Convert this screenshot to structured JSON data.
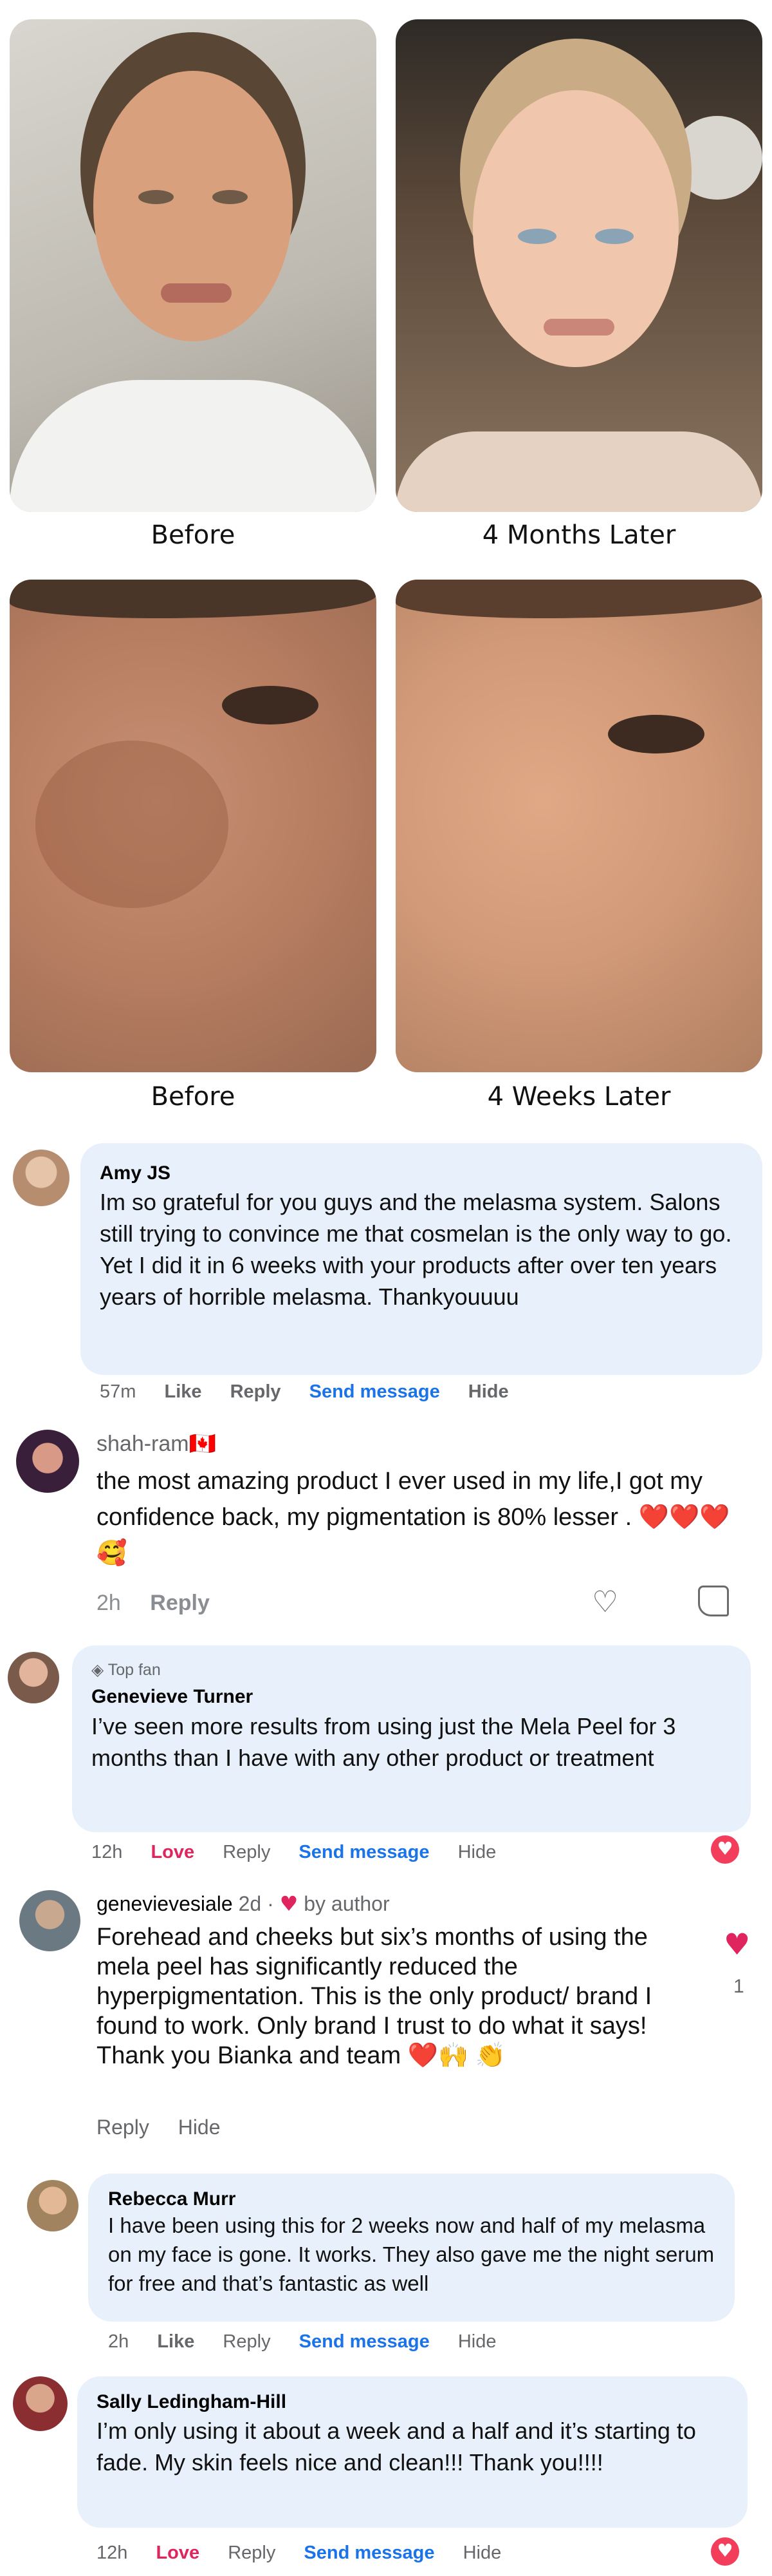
{
  "photos": {
    "top_left_caption": "Before",
    "top_right_caption": "4 Months Later",
    "bottom_left_caption": "Before",
    "bottom_right_caption": "4 Weeks Later"
  },
  "comments": [
    {
      "name": "Amy JS",
      "text": "Im so grateful for you guys and the melasma system. Salons still trying to convince me that cosmelan is the only way to go. Yet I did it in 6 weeks with your products after over ten years years of horrible melasma. Thankyouuuu",
      "time": "57m",
      "like": "Like",
      "reply": "Reply",
      "send": "Send message",
      "hide": "Hide"
    },
    {
      "name": "shah-ram🇨🇦",
      "text": "the most amazing product I ever used in my life,I got my confidence back, my pigmentation is 80% lesser .",
      "emoji": "❤️❤️❤️🥰",
      "time": "2h",
      "reply": "Reply"
    },
    {
      "badge": "Top fan",
      "name": "Genevieve Turner",
      "text": "I’ve seen more results from using just the Mela Peel for 3 months than I have with any other product or treatment",
      "time": "12h",
      "love": "Love",
      "reply": "Reply",
      "send": "Send message",
      "hide": "Hide"
    },
    {
      "name": "genevievesiale",
      "age": "2d",
      "by_author": "by author",
      "text": "Forehead and cheeks but six’s months of using the mela peel has significantly reduced the hyperpigmentation. This is the only product/ brand I found to work. Only brand I trust to do what it says! Thank you Bianka and team",
      "emoji": "❤️🙌 👏",
      "reply": "Reply",
      "hide": "Hide",
      "like_count": "1"
    },
    {
      "name": "Rebecca Murr",
      "text": "I have been using this for 2 weeks now and half of my melasma on my face is gone. It works. They also gave me the night serum for free and that’s fantastic as well",
      "time": "2h",
      "like": "Like",
      "reply": "Reply",
      "send": "Send message",
      "hide": "Hide"
    },
    {
      "name": "Sally Ledingham-Hill",
      "text": "I’m only using it about a week and a half and it’s starting to fade. My skin feels nice and clean!!! Thank you!!!!",
      "time": "12h",
      "love": "Love",
      "reply": "Reply",
      "send": "Send message",
      "hide": "Hide"
    }
  ]
}
